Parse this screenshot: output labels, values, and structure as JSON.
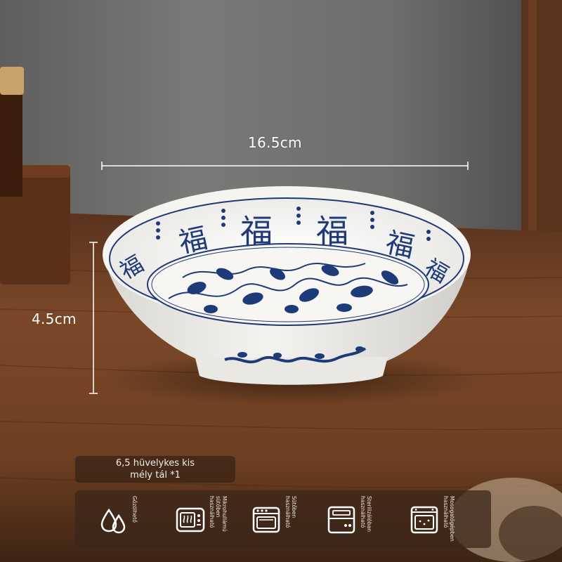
{
  "dimensions": {
    "diameter": "16.5cm",
    "height": "4.5cm"
  },
  "bowl_pattern": {
    "rim_character": "福",
    "colors": {
      "glaze": "#f3f2ee",
      "cobalt": "#1f3a78",
      "table": "#6b3d22"
    }
  },
  "caption": {
    "line1": "6,5 hüvelykes kis",
    "line2": "mély tál *1"
  },
  "features": [
    {
      "icon": "water-drops-icon",
      "label": "Gőzölhető"
    },
    {
      "icon": "microwave-icon",
      "label": "Mikrohullámú sütőben használható"
    },
    {
      "icon": "oven-icon",
      "label": "Sütőben használható"
    },
    {
      "icon": "sterilizer-icon",
      "label": "Sterilizálóban használható"
    },
    {
      "icon": "dishwasher-icon",
      "label": "Mosogatógépben használható"
    }
  ]
}
